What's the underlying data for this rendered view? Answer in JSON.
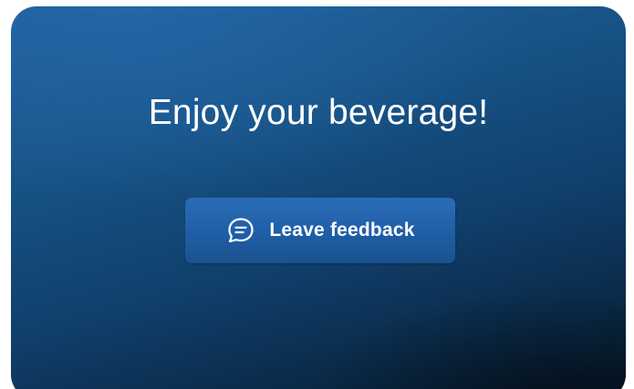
{
  "screen": {
    "headline": "Enjoy your beverage!",
    "feedback_button": {
      "label": "Leave feedback",
      "icon": "chat-bubble-icon"
    }
  },
  "colors": {
    "background_top": "#1f5f98",
    "background_bottom": "#07192b",
    "button": "#2264ab",
    "text": "#ffffff"
  }
}
